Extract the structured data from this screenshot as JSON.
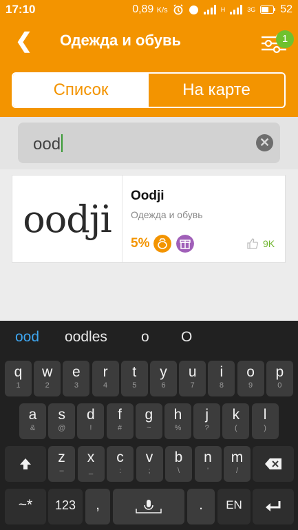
{
  "status": {
    "time": "17:10",
    "speed": "0,89",
    "speed_unit": "K/s",
    "net_h": "H",
    "net_3g": "3G",
    "battery": "52"
  },
  "header": {
    "back": "❮",
    "title": "Одежда и обувь",
    "filter_badge": "1"
  },
  "tabs": [
    {
      "label": "Список",
      "active": true
    },
    {
      "label": "На карте",
      "active": false
    }
  ],
  "search": {
    "value": "ood",
    "clear": "✕"
  },
  "results": [
    {
      "logo": "oodji",
      "name": "Oodji",
      "category": "Одежда и обувь",
      "cashback": "5%",
      "likes": "9K"
    }
  ],
  "keyboard": {
    "suggestions": [
      "ood",
      "oodles",
      "o",
      "O"
    ],
    "row1": [
      {
        "k": "q",
        "s": "1"
      },
      {
        "k": "w",
        "s": "2"
      },
      {
        "k": "e",
        "s": "3"
      },
      {
        "k": "r",
        "s": "4"
      },
      {
        "k": "t",
        "s": "5"
      },
      {
        "k": "y",
        "s": "6"
      },
      {
        "k": "u",
        "s": "7"
      },
      {
        "k": "i",
        "s": "8"
      },
      {
        "k": "o",
        "s": "9"
      },
      {
        "k": "p",
        "s": "0"
      }
    ],
    "row2": [
      {
        "k": "a",
        "s": "&"
      },
      {
        "k": "s",
        "s": "@"
      },
      {
        "k": "d",
        "s": "!"
      },
      {
        "k": "f",
        "s": "#"
      },
      {
        "k": "g",
        "s": "~"
      },
      {
        "k": "h",
        "s": "%"
      },
      {
        "k": "j",
        "s": "?"
      },
      {
        "k": "k",
        "s": "("
      },
      {
        "k": "l",
        "s": ")"
      }
    ],
    "row3": [
      {
        "k": "z",
        "s": "–"
      },
      {
        "k": "x",
        "s": "_"
      },
      {
        "k": "c",
        "s": ":"
      },
      {
        "k": "v",
        "s": ";"
      },
      {
        "k": "b",
        "s": "\\"
      },
      {
        "k": "n",
        "s": "'"
      },
      {
        "k": "m",
        "s": "/"
      }
    ],
    "symbols_key": "~*",
    "numbers_key": "123",
    "comma_key": ",",
    "period_key": ".",
    "lang_key": "EN"
  }
}
